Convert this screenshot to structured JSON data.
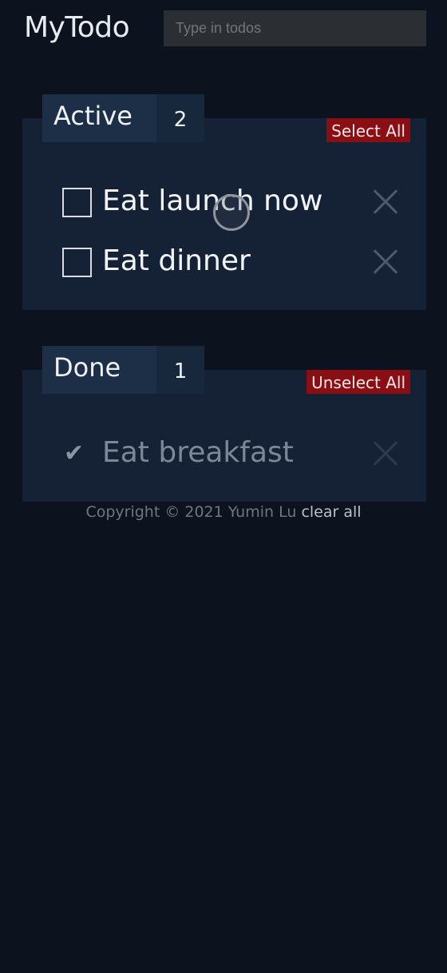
{
  "header": {
    "title": "MyTodo",
    "input_placeholder": "Type in todos",
    "input_value": ""
  },
  "active": {
    "label": "Active",
    "count": "2",
    "bulk_label": "Select All",
    "items": [
      {
        "text": "Eat launch now",
        "checked": false
      },
      {
        "text": "Eat dinner",
        "checked": false
      }
    ]
  },
  "done": {
    "label": "Done",
    "count": "1",
    "bulk_label": "Unselect All",
    "items": [
      {
        "text": "Eat breakfast",
        "checked": true,
        "check_glyph": "✔"
      }
    ]
  },
  "footer": {
    "copyright": "Copyright © 2021 Yumin Lu",
    "clear_label": "clear all"
  },
  "colors": {
    "background": "#0c131e",
    "panel": "#152235",
    "accent_red": "#8a0f14"
  },
  "icons": {
    "delete": "close-icon",
    "done_check": "checkmark-icon"
  }
}
